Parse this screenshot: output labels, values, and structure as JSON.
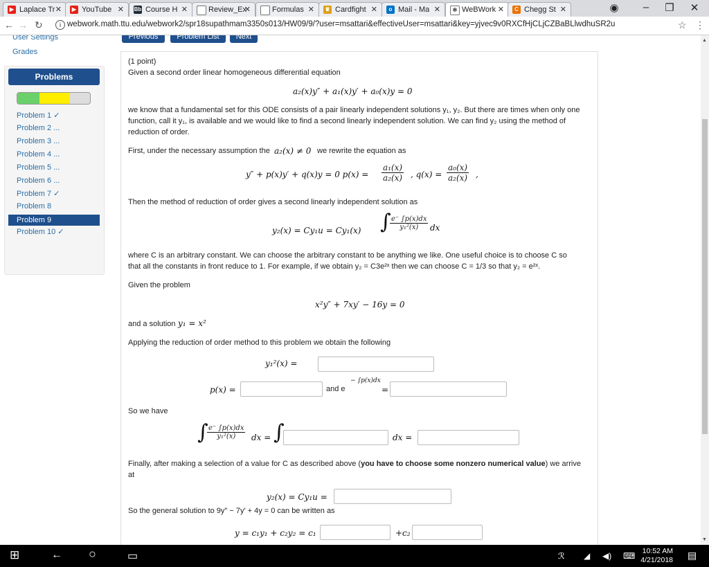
{
  "tabs": [
    {
      "title": "Laplace Tr",
      "fav_color": "#e62117",
      "fav_glyph": "▶"
    },
    {
      "title": "YouTube",
      "fav_color": "#e62117",
      "fav_glyph": "▶"
    },
    {
      "title": "Course H",
      "fav_color": "#1b2a36",
      "fav_glyph": "Bb"
    },
    {
      "title": "Review_Ex",
      "fav_color": "#ffffff",
      "fav_glyph": ""
    },
    {
      "title": "Formulas",
      "fav_color": "#ffffff",
      "fav_glyph": ""
    },
    {
      "title": "Cardfight",
      "fav_color": "#e0a010",
      "fav_glyph": "♛"
    },
    {
      "title": "Mail - Ma",
      "fav_color": "#0072c6",
      "fav_glyph": "o"
    },
    {
      "title": "WeBWork",
      "fav_color": "#ffffff",
      "fav_glyph": "✲"
    },
    {
      "title": "Chegg St",
      "fav_color": "#eb7100",
      "fav_glyph": "C"
    }
  ],
  "url": "webwork.math.ttu.edu/webwork2/spr18supathmam3350s013/HW09/9/?user=msattari&effectiveUser=msattari&key=yjvec9v0RXCfHjCLjCZBaBLlwdhuSR2u",
  "nav": {
    "user_settings": "User Settings",
    "grades": "Grades",
    "previous": "Previous",
    "problem_list": "Problem List",
    "next": "Next"
  },
  "sidebar": {
    "header": "Problems",
    "progress": {
      "correct": 0.3,
      "incorrect": 0.42
    },
    "problems": [
      "Problem 1 ✓",
      "Problem 2 ...",
      "Problem 3 ...",
      "Problem 4 ...",
      "Problem 5 ...",
      "Problem 6 ...",
      "Problem 7 ✓",
      "Problem 8",
      "Problem 9",
      "Problem 10 ✓"
    ]
  },
  "problem": {
    "points": "(1 point)",
    "intro": "Given a second order linear homogeneous differential equation",
    "eq1": "a₂(x)y″ + a₁(x)y′ + a₀(x)y = 0",
    "p1_line1": "we know that a fundamental set for this ODE consists of a pair linearly independent solutions y₁, y₂. But there are times when only one",
    "p1_line2": "function, call it y₁, is available and we would like to find a second linearly independent solution. We can find y₂ using the method of",
    "p1_line3": "reduction of order.",
    "p2_pre": "First, under the necessary assumption the",
    "p2_math": "a₂(x) ≠ 0",
    "p2_post": "we rewrite the equation as",
    "eq2_left": "y″ + p(x)y′ + q(x)y = 0   p(x) =",
    "eq2_f1_num": "a₁(x)",
    "eq2_f1_den": "a₂(x)",
    "eq2_mid": ",  q(x) =",
    "eq2_f2_num": "a₀(x)",
    "eq2_f2_den": "a₂(x)",
    "eq2_end": ",",
    "p3": "Then the method of reduction of order gives a second linearly independent solution as",
    "eq3_left": "y₂(x) = Cy₁u = Cy₁(x)",
    "eq3_num": "e⁻ ∫p(x)dx",
    "eq3_den": "y₁²(x)",
    "eq3_dx": "dx",
    "p4_line1": "where C is an arbitrary constant. We can choose the arbitrary constant to be anything we like. One useful choice is to choose C so",
    "p4_line2": "that all the constants in front reduce to 1. For example, if we obtain y₂ = C3e²ˣ then we can choose C = 1/3 so that y₂ = e²ˣ.",
    "given": "Given the problem",
    "eq4": "x²y″ + 7xy′ − 16y = 0",
    "solution_pre": "and a solution",
    "solution_math": "y₁ = x²",
    "applying": "Applying the reduction of order method to this problem we obtain the following",
    "y1sq_label": "y₁²(x) =",
    "p_label": "p(x) =",
    "and_e": "and e",
    "and_e_sup": "− ∫p(x)dx",
    "eq_sign": "=",
    "so_we_have": "So we have",
    "int_num": "e⁻ ∫p(x)dx",
    "int_den": "y₁²(x)",
    "int_dx_eq": "dx =",
    "int_dx_eq2": "dx =",
    "finally_line1": "Finally, after making a selection of a value for C as described above (",
    "finally_bold": "you have to choose some nonzero numerical value",
    "finally_line1_end": ") we arrive",
    "finally_line2": "at",
    "y2_label": "y₂(x) = Cy₁u =",
    "general": "So the general solution to 9y″ − 7y′ + 4y = 0 can be written as",
    "gen_left": "y = c₁y₁ + c₂y₂ = c₁",
    "gen_plus": "+c₂"
  },
  "taskbar": {
    "time": "10:52 AM",
    "date": "4/21/2018"
  }
}
